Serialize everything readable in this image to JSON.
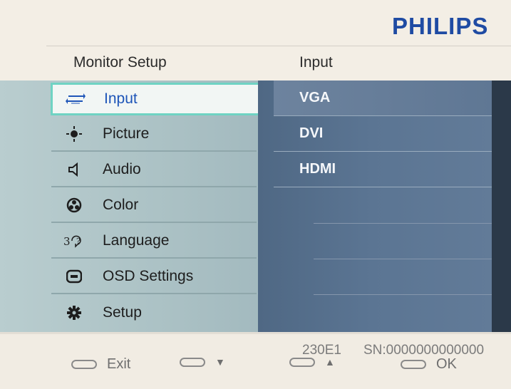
{
  "header": {
    "brand": "PHILIPS",
    "title_left": "Monitor Setup",
    "title_right": "Input"
  },
  "menu": {
    "items": [
      {
        "label": "Input",
        "icon": "input-arrows-icon"
      },
      {
        "label": "Picture",
        "icon": "sun-icon"
      },
      {
        "label": "Audio",
        "icon": "speaker-icon"
      },
      {
        "label": "Color",
        "icon": "color-wheel-icon"
      },
      {
        "label": "Language",
        "icon": "language-icon"
      },
      {
        "label": "OSD Settings",
        "icon": "display-icon"
      },
      {
        "label": "Setup",
        "icon": "gear-icon"
      }
    ],
    "active_index": 0
  },
  "submenu": {
    "items": [
      "VGA",
      "DVI",
      "HDMI"
    ],
    "selected_index": 0
  },
  "footer": {
    "model": "230E1",
    "serial": "SN:0000000000000",
    "buttons": [
      {
        "label": "Exit",
        "glyph": ""
      },
      {
        "label": "",
        "glyph": "▼"
      },
      {
        "label": "",
        "glyph": "▲"
      },
      {
        "label": "OK",
        "glyph": ""
      }
    ]
  },
  "colors": {
    "brand": "#1f4ba3",
    "active_border": "#6fd3c3",
    "left_panel": "#adc3c6",
    "right_panel": "#5b7593"
  }
}
